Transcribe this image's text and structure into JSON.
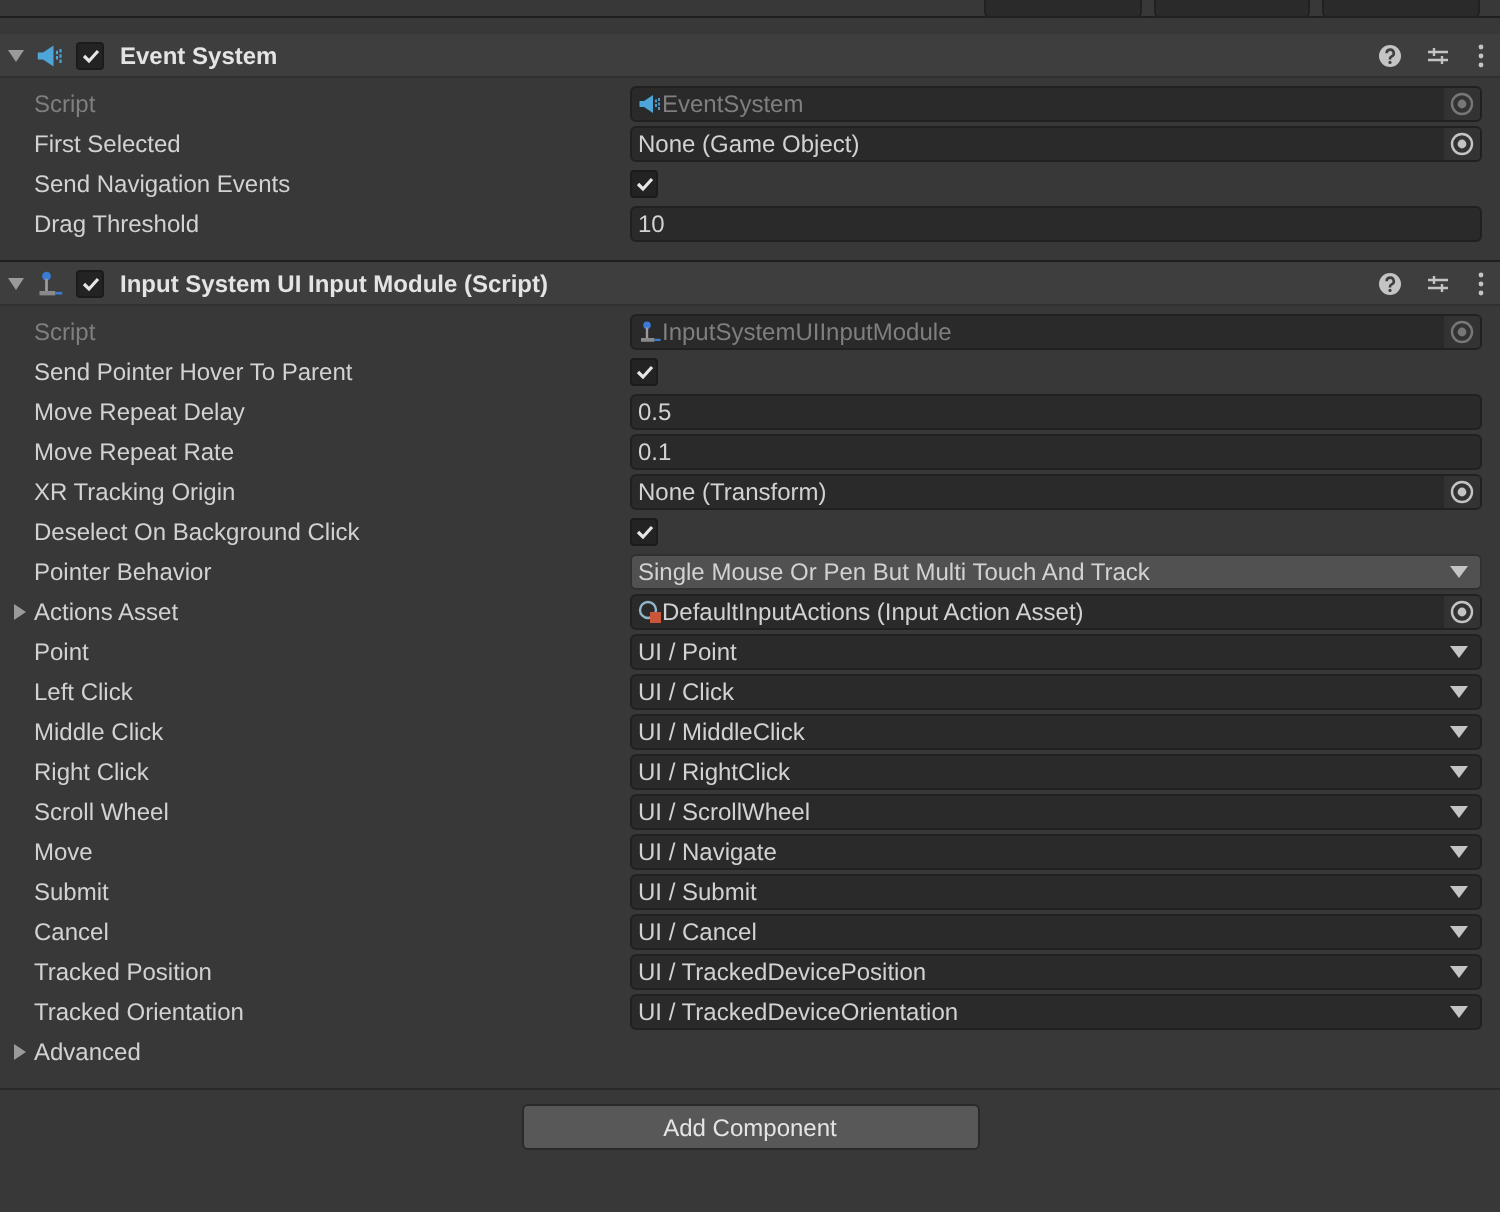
{
  "components": [
    {
      "title": "Event System",
      "enabled": true,
      "expanded": true,
      "properties": [
        {
          "label": "Script",
          "kind": "script",
          "value": "EventSystem",
          "disabled": true
        },
        {
          "label": "First Selected",
          "kind": "object",
          "value": "None (Game Object)"
        },
        {
          "label": "Send Navigation Events",
          "kind": "check",
          "checked": true
        },
        {
          "label": "Drag Threshold",
          "kind": "text",
          "value": "10"
        }
      ]
    },
    {
      "title": "Input System UI Input Module (Script)",
      "enabled": true,
      "expanded": true,
      "properties": [
        {
          "label": "Script",
          "kind": "script",
          "value": "InputSystemUIInputModule",
          "disabled": true
        },
        {
          "label": "Send Pointer Hover To Parent",
          "kind": "check",
          "checked": true
        },
        {
          "label": "Move Repeat Delay",
          "kind": "text",
          "value": "0.5"
        },
        {
          "label": "Move Repeat Rate",
          "kind": "text",
          "value": "0.1"
        },
        {
          "label": "XR Tracking Origin",
          "kind": "object",
          "value": "None (Transform)"
        },
        {
          "label": "Deselect On Background Click",
          "kind": "check",
          "checked": true
        },
        {
          "label": "Pointer Behavior",
          "kind": "enum",
          "value": "Single Mouse Or Pen But Multi Touch And Track"
        },
        {
          "label": "Actions Asset",
          "kind": "asset",
          "value": "DefaultInputActions (Input Action Asset)",
          "expanded": false
        },
        {
          "label": "Point",
          "kind": "action",
          "value": "UI / Point"
        },
        {
          "label": "Left Click",
          "kind": "action",
          "value": "UI / Click"
        },
        {
          "label": "Middle Click",
          "kind": "action",
          "value": "UI / MiddleClick"
        },
        {
          "label": "Right Click",
          "kind": "action",
          "value": "UI / RightClick"
        },
        {
          "label": "Scroll Wheel",
          "kind": "action",
          "value": "UI / ScrollWheel"
        },
        {
          "label": "Move",
          "kind": "action",
          "value": "UI / Navigate"
        },
        {
          "label": "Submit",
          "kind": "action",
          "value": "UI / Submit"
        },
        {
          "label": "Cancel",
          "kind": "action",
          "value": "UI / Cancel"
        },
        {
          "label": "Tracked Position",
          "kind": "action",
          "value": "UI / TrackedDevicePosition"
        },
        {
          "label": "Tracked Orientation",
          "kind": "action",
          "value": "UI / TrackedDeviceOrientation"
        },
        {
          "label": "Advanced",
          "kind": "foldout",
          "expanded": false
        }
      ]
    }
  ],
  "add_button": "Add Component"
}
